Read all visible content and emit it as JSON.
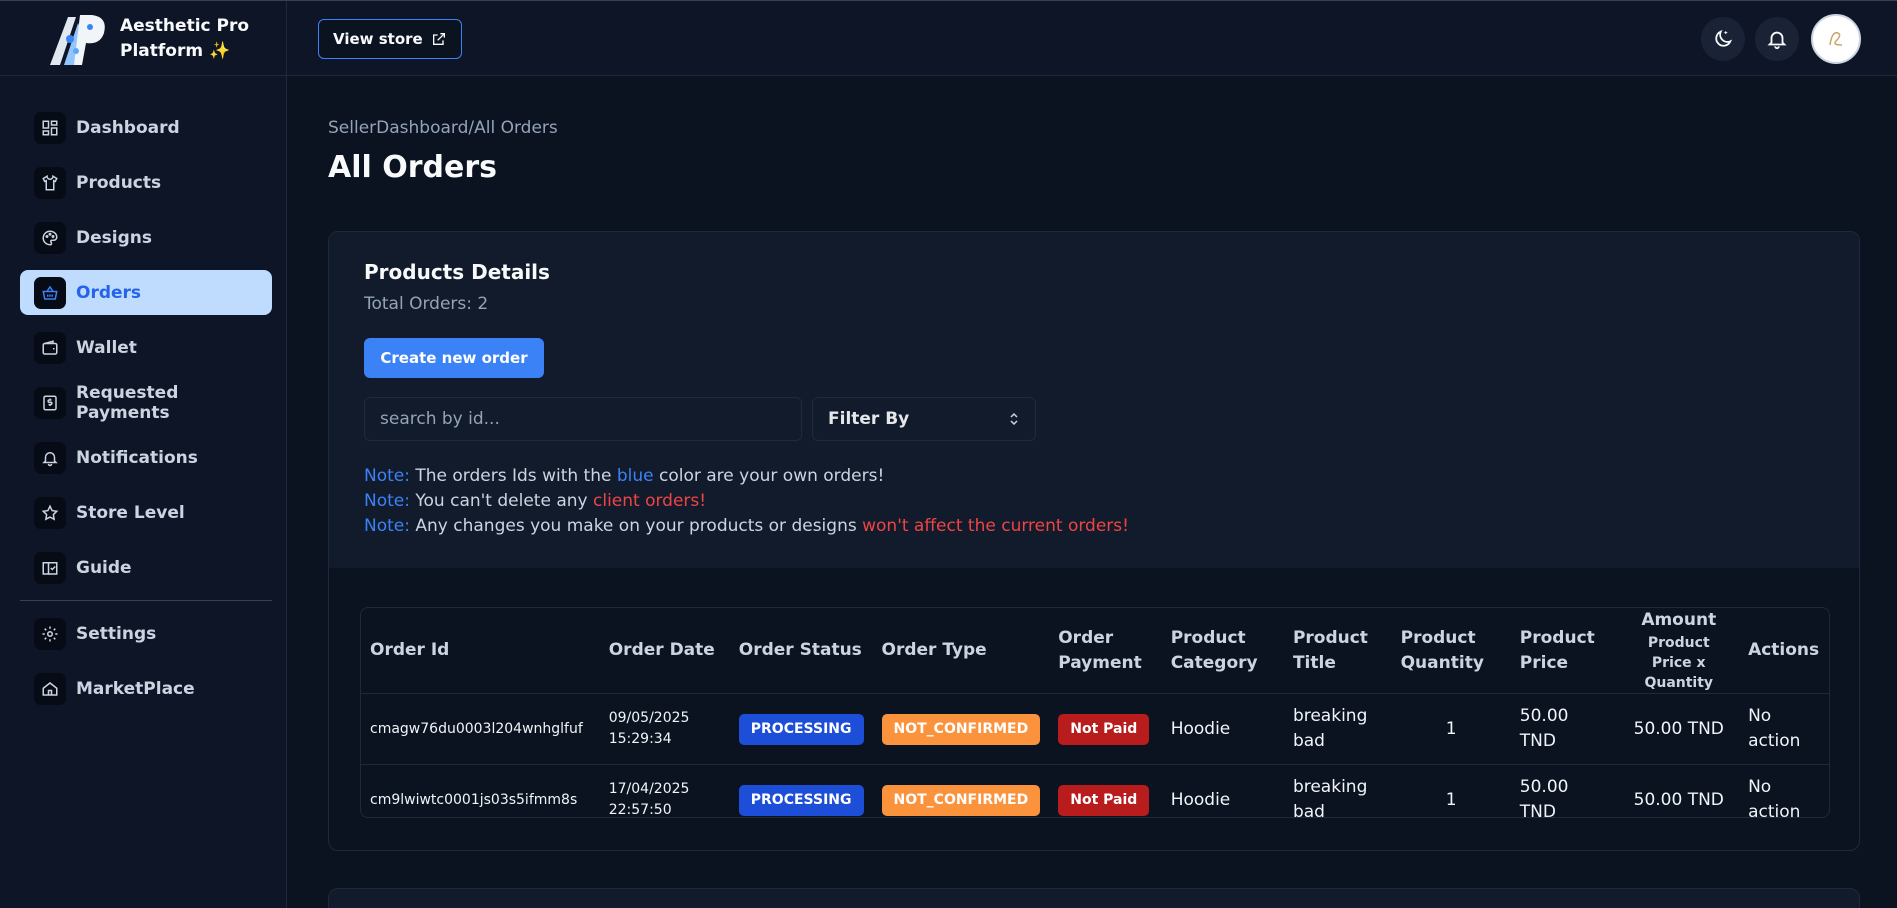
{
  "brand": {
    "name": "Aesthetic Pro Platform ✨"
  },
  "header": {
    "view_store_label": "View store",
    "icons": [
      "theme-toggle-icon",
      "bell-icon",
      "avatar"
    ]
  },
  "sidebar": {
    "items": [
      {
        "label": "Dashboard",
        "icon": "dashboard-icon"
      },
      {
        "label": "Products",
        "icon": "shirt-icon"
      },
      {
        "label": "Designs",
        "icon": "palette-icon"
      },
      {
        "label": "Orders",
        "icon": "basket-icon",
        "active": true
      },
      {
        "label": "Wallet",
        "icon": "wallet-icon"
      },
      {
        "label": "Requested Payments",
        "icon": "dollar-icon"
      },
      {
        "label": "Notifications",
        "icon": "bell-icon"
      },
      {
        "label": "Store Level",
        "icon": "star-icon"
      },
      {
        "label": "Guide",
        "icon": "book-icon"
      },
      {
        "label": "Settings",
        "icon": "gear-icon"
      },
      {
        "label": "MarketPlace",
        "icon": "home-icon"
      }
    ]
  },
  "main": {
    "breadcrumb": "SellerDashboard/All Orders",
    "title": "All Orders",
    "card": {
      "title": "Products Details",
      "total_orders": "Total Orders: 2",
      "create_button": "Create new order",
      "search_placeholder": "search by id...",
      "filter_label": "Filter By",
      "notes": {
        "label": "Note:",
        "n1_pre": " The orders Ids with the ",
        "n1_blue": "blue",
        "n1_post": " color are your own orders!",
        "n2_pre": " You can't delete any ",
        "n2_red": "client orders!",
        "n3_pre": " Any changes you make on your products or designs ",
        "n3_red": "won't affect the current orders!"
      }
    },
    "table": {
      "headers": {
        "order_id": "Order Id",
        "order_date": "Order Date",
        "order_status": "Order Status",
        "order_type": "Order Type",
        "order_payment": "Order Payment",
        "product_category": "Product Category",
        "product_title": "Product Title",
        "product_quantity": "Product Quantity",
        "product_price": "Product Price",
        "amount": "Amount",
        "amount_sub": "Product Price x Quantity",
        "actions": "Actions"
      },
      "rows": [
        {
          "order_id": "cmagw76du0003l204wnhglfuf",
          "date": "09/05/2025",
          "time": "15:29:34",
          "status": "PROCESSING",
          "type": "NOT_CONFIRMED",
          "payment": "Not Paid",
          "category": "Hoodie",
          "title": "breaking bad",
          "quantity": "1",
          "price": "50.00 TND",
          "amount": "50.00 TND",
          "action": "No action"
        },
        {
          "order_id": "cm9lwiwtc0001js03s5ifmm8s",
          "date": "17/04/2025",
          "time": "22:57:50",
          "status": "PROCESSING",
          "type": "NOT_CONFIRMED",
          "payment": "Not Paid",
          "category": "Hoodie",
          "title": "breaking bad",
          "quantity": "1",
          "price": "50.00 TND",
          "amount": "50.00 TND",
          "action": "No action"
        }
      ]
    }
  },
  "colors": {
    "accent": "#3b82f6",
    "active_nav_bg": "#bfdbfe",
    "processing": "#1d4ed8",
    "not_confirmed": "#fb923c",
    "not_paid": "#b91c1c",
    "danger_text": "#ef4444"
  }
}
